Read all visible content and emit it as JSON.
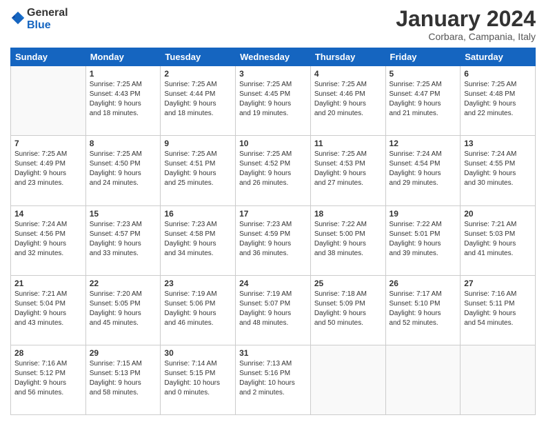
{
  "header": {
    "logo_general": "General",
    "logo_blue": "Blue",
    "month_title": "January 2024",
    "location": "Corbara, Campania, Italy"
  },
  "days_of_week": [
    "Sunday",
    "Monday",
    "Tuesday",
    "Wednesday",
    "Thursday",
    "Friday",
    "Saturday"
  ],
  "weeks": [
    [
      {
        "day": "",
        "info": ""
      },
      {
        "day": "1",
        "info": "Sunrise: 7:25 AM\nSunset: 4:43 PM\nDaylight: 9 hours\nand 18 minutes."
      },
      {
        "day": "2",
        "info": "Sunrise: 7:25 AM\nSunset: 4:44 PM\nDaylight: 9 hours\nand 18 minutes."
      },
      {
        "day": "3",
        "info": "Sunrise: 7:25 AM\nSunset: 4:45 PM\nDaylight: 9 hours\nand 19 minutes."
      },
      {
        "day": "4",
        "info": "Sunrise: 7:25 AM\nSunset: 4:46 PM\nDaylight: 9 hours\nand 20 minutes."
      },
      {
        "day": "5",
        "info": "Sunrise: 7:25 AM\nSunset: 4:47 PM\nDaylight: 9 hours\nand 21 minutes."
      },
      {
        "day": "6",
        "info": "Sunrise: 7:25 AM\nSunset: 4:48 PM\nDaylight: 9 hours\nand 22 minutes."
      }
    ],
    [
      {
        "day": "7",
        "info": "Sunrise: 7:25 AM\nSunset: 4:49 PM\nDaylight: 9 hours\nand 23 minutes."
      },
      {
        "day": "8",
        "info": "Sunrise: 7:25 AM\nSunset: 4:50 PM\nDaylight: 9 hours\nand 24 minutes."
      },
      {
        "day": "9",
        "info": "Sunrise: 7:25 AM\nSunset: 4:51 PM\nDaylight: 9 hours\nand 25 minutes."
      },
      {
        "day": "10",
        "info": "Sunrise: 7:25 AM\nSunset: 4:52 PM\nDaylight: 9 hours\nand 26 minutes."
      },
      {
        "day": "11",
        "info": "Sunrise: 7:25 AM\nSunset: 4:53 PM\nDaylight: 9 hours\nand 27 minutes."
      },
      {
        "day": "12",
        "info": "Sunrise: 7:24 AM\nSunset: 4:54 PM\nDaylight: 9 hours\nand 29 minutes."
      },
      {
        "day": "13",
        "info": "Sunrise: 7:24 AM\nSunset: 4:55 PM\nDaylight: 9 hours\nand 30 minutes."
      }
    ],
    [
      {
        "day": "14",
        "info": "Sunrise: 7:24 AM\nSunset: 4:56 PM\nDaylight: 9 hours\nand 32 minutes."
      },
      {
        "day": "15",
        "info": "Sunrise: 7:23 AM\nSunset: 4:57 PM\nDaylight: 9 hours\nand 33 minutes."
      },
      {
        "day": "16",
        "info": "Sunrise: 7:23 AM\nSunset: 4:58 PM\nDaylight: 9 hours\nand 34 minutes."
      },
      {
        "day": "17",
        "info": "Sunrise: 7:23 AM\nSunset: 4:59 PM\nDaylight: 9 hours\nand 36 minutes."
      },
      {
        "day": "18",
        "info": "Sunrise: 7:22 AM\nSunset: 5:00 PM\nDaylight: 9 hours\nand 38 minutes."
      },
      {
        "day": "19",
        "info": "Sunrise: 7:22 AM\nSunset: 5:01 PM\nDaylight: 9 hours\nand 39 minutes."
      },
      {
        "day": "20",
        "info": "Sunrise: 7:21 AM\nSunset: 5:03 PM\nDaylight: 9 hours\nand 41 minutes."
      }
    ],
    [
      {
        "day": "21",
        "info": "Sunrise: 7:21 AM\nSunset: 5:04 PM\nDaylight: 9 hours\nand 43 minutes."
      },
      {
        "day": "22",
        "info": "Sunrise: 7:20 AM\nSunset: 5:05 PM\nDaylight: 9 hours\nand 45 minutes."
      },
      {
        "day": "23",
        "info": "Sunrise: 7:19 AM\nSunset: 5:06 PM\nDaylight: 9 hours\nand 46 minutes."
      },
      {
        "day": "24",
        "info": "Sunrise: 7:19 AM\nSunset: 5:07 PM\nDaylight: 9 hours\nand 48 minutes."
      },
      {
        "day": "25",
        "info": "Sunrise: 7:18 AM\nSunset: 5:09 PM\nDaylight: 9 hours\nand 50 minutes."
      },
      {
        "day": "26",
        "info": "Sunrise: 7:17 AM\nSunset: 5:10 PM\nDaylight: 9 hours\nand 52 minutes."
      },
      {
        "day": "27",
        "info": "Sunrise: 7:16 AM\nSunset: 5:11 PM\nDaylight: 9 hours\nand 54 minutes."
      }
    ],
    [
      {
        "day": "28",
        "info": "Sunrise: 7:16 AM\nSunset: 5:12 PM\nDaylight: 9 hours\nand 56 minutes."
      },
      {
        "day": "29",
        "info": "Sunrise: 7:15 AM\nSunset: 5:13 PM\nDaylight: 9 hours\nand 58 minutes."
      },
      {
        "day": "30",
        "info": "Sunrise: 7:14 AM\nSunset: 5:15 PM\nDaylight: 10 hours\nand 0 minutes."
      },
      {
        "day": "31",
        "info": "Sunrise: 7:13 AM\nSunset: 5:16 PM\nDaylight: 10 hours\nand 2 minutes."
      },
      {
        "day": "",
        "info": ""
      },
      {
        "day": "",
        "info": ""
      },
      {
        "day": "",
        "info": ""
      }
    ]
  ]
}
